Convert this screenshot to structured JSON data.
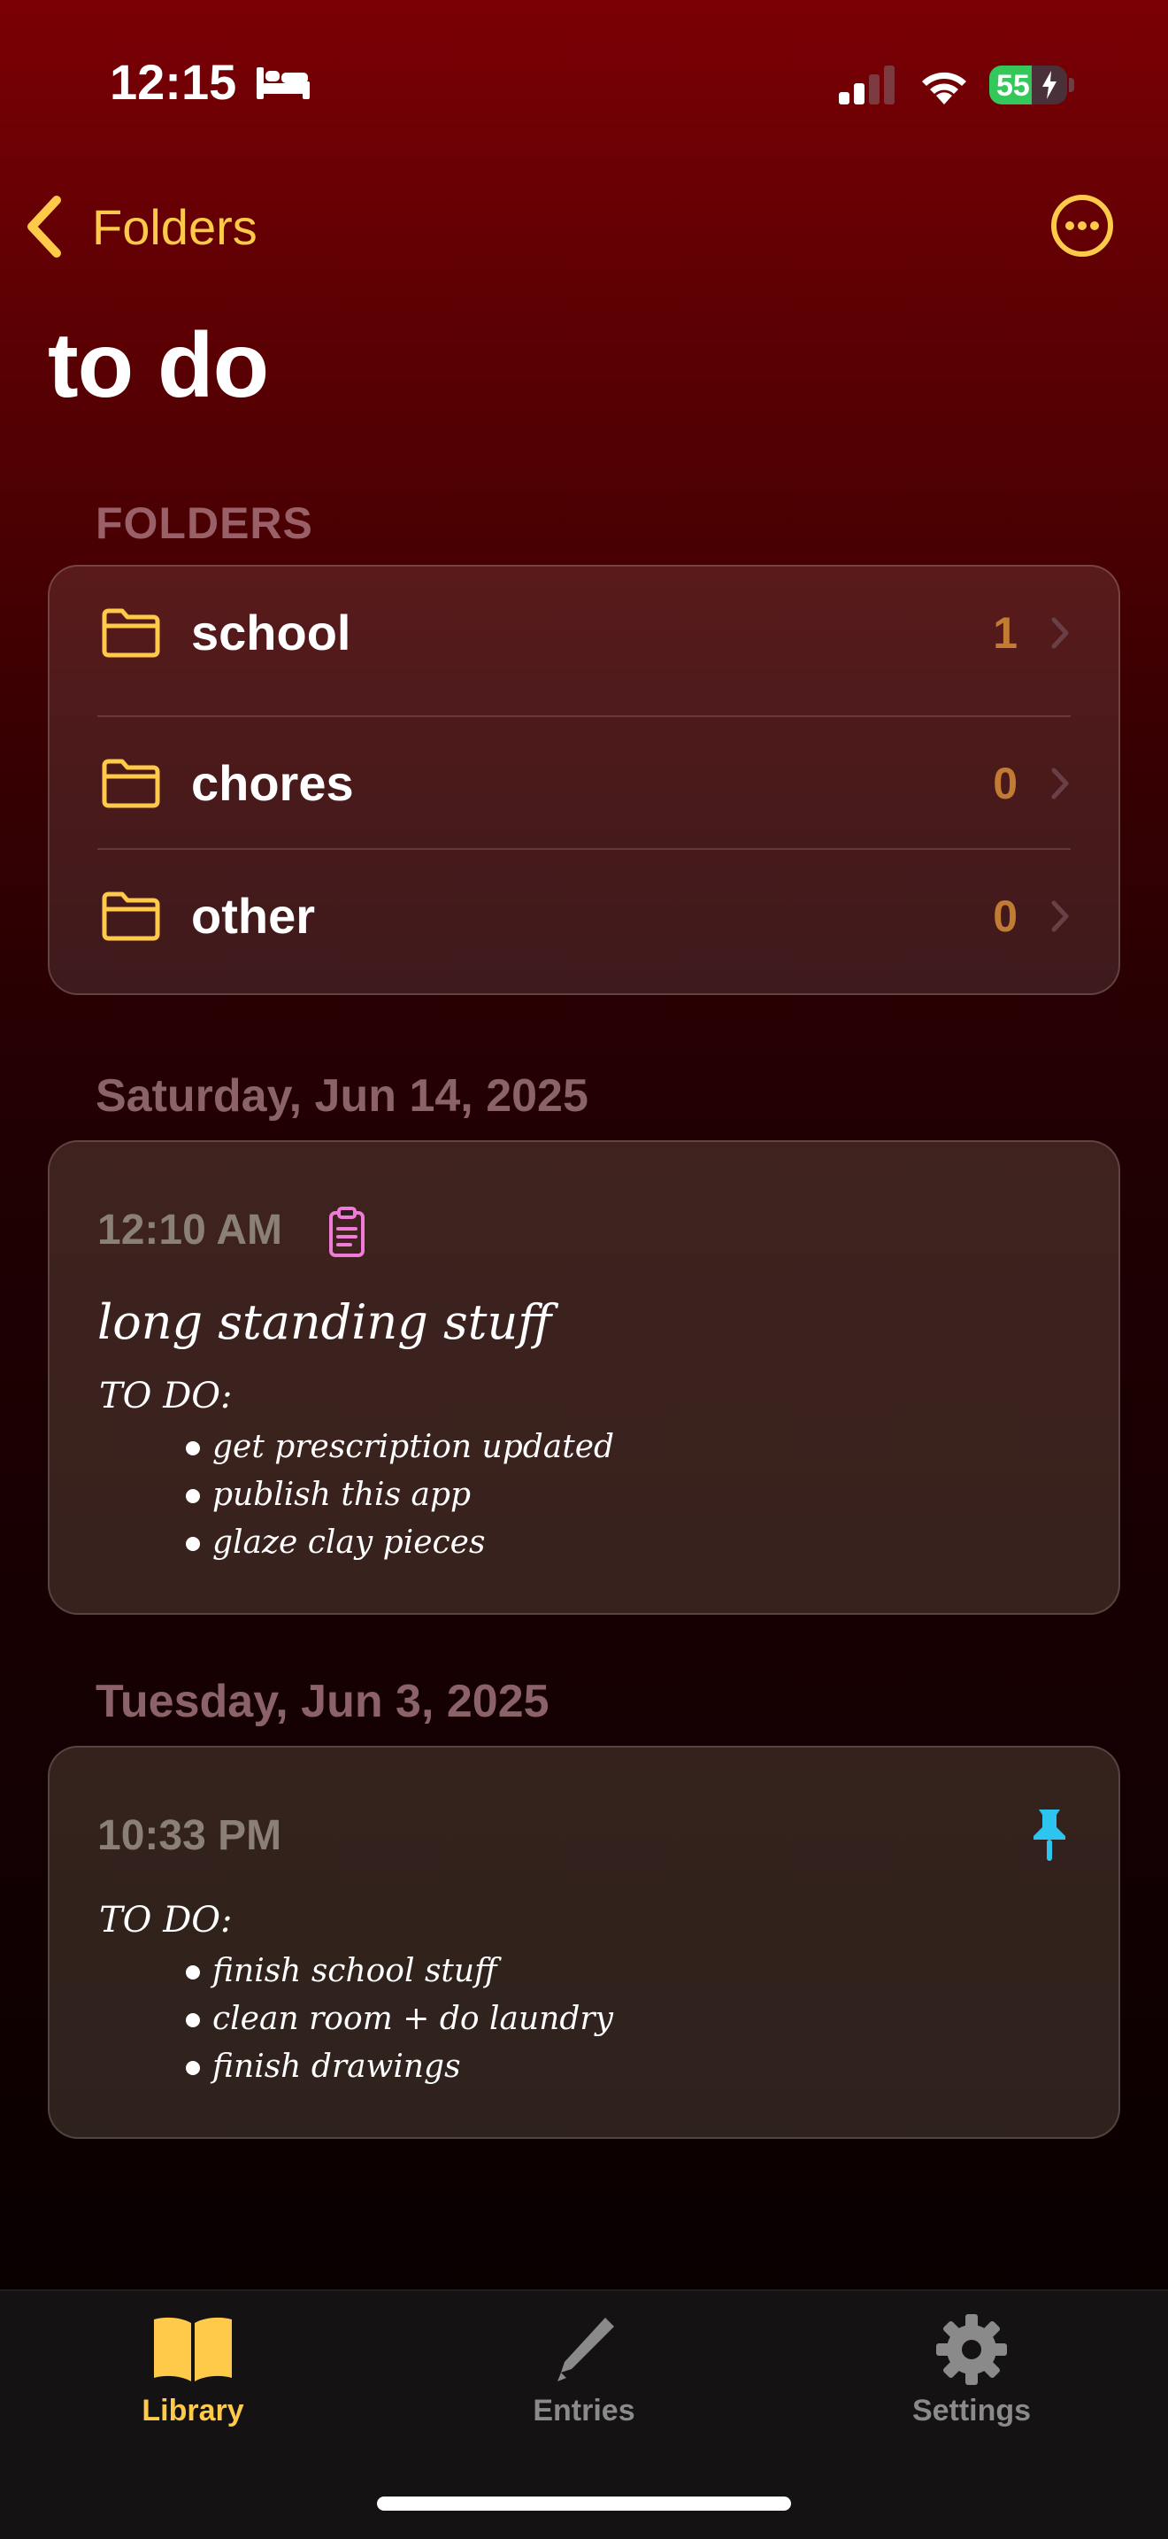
{
  "status_bar": {
    "time": "12:15",
    "battery_level": "55",
    "battery_fraction": 0.55
  },
  "nav": {
    "back_label": "Folders",
    "title": "to do"
  },
  "folders_section": {
    "label": "FOLDERS",
    "items": [
      {
        "name": "school",
        "count": "1"
      },
      {
        "name": "chores",
        "count": "0"
      },
      {
        "name": "other",
        "count": "0"
      }
    ]
  },
  "entries": [
    {
      "date": "Saturday, Jun 14, 2025",
      "time": "12:10 AM",
      "title": "long standing stuff",
      "heading": "TO DO:",
      "items": [
        "get prescription updated",
        "publish this app",
        "glaze clay pieces"
      ]
    },
    {
      "date": "Tuesday, Jun 3, 2025",
      "time": "10:33 PM",
      "heading": "TO DO:",
      "items": [
        "finish school stuff",
        "clean room + do laundry",
        "finish drawings"
      ]
    }
  ],
  "tabs": [
    {
      "label": "Library",
      "icon": "book-icon",
      "active": true
    },
    {
      "label": "Entries",
      "icon": "pencil-icon",
      "active": false
    },
    {
      "label": "Settings",
      "icon": "gear-icon",
      "active": false
    }
  ],
  "colors": {
    "accent": "#ffc94a",
    "count": "#c17b33",
    "clipboard": "#f07ad8",
    "pin": "#2ec4f0",
    "tab_inactive": "#8a8a8a"
  }
}
